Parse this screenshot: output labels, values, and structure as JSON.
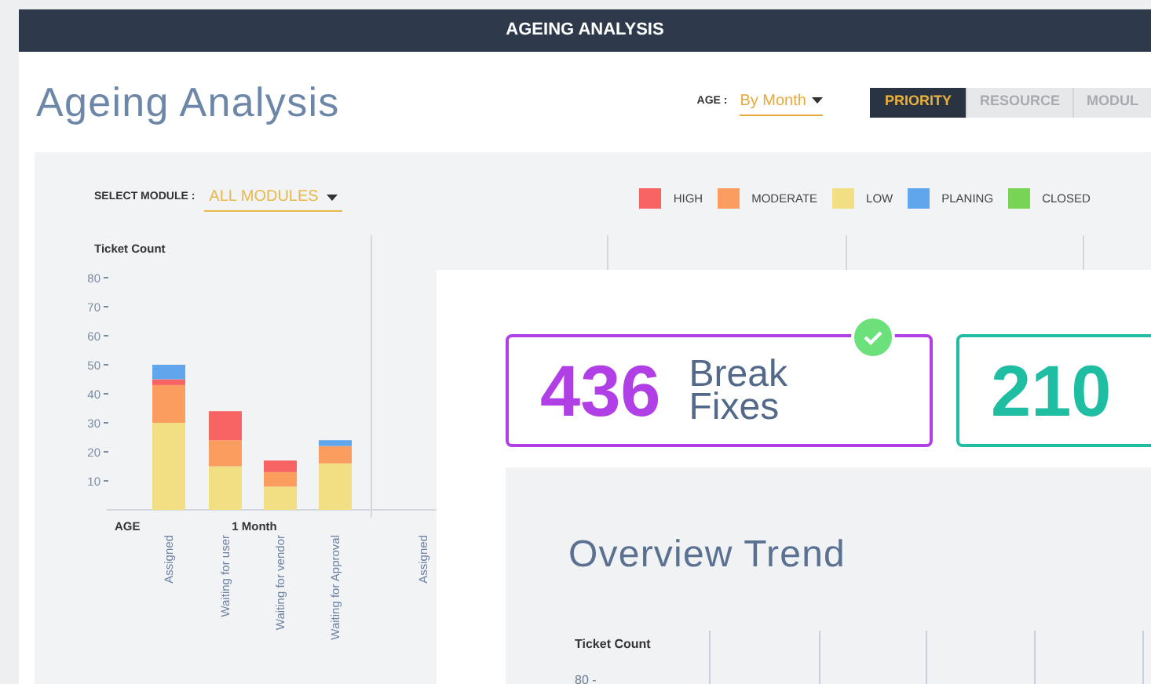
{
  "window": {
    "title": "AGEING ANALYSIS"
  },
  "page_title": "Ageing Analysis",
  "age_filter": {
    "label": "AGE :",
    "value": "By Month"
  },
  "tabs": [
    {
      "label": "PRIORITY",
      "selected": true
    },
    {
      "label": "RESOURCE",
      "selected": false
    },
    {
      "label": "MODUL",
      "selected": false
    }
  ],
  "module_filter": {
    "label": "SELECT MODULE :",
    "value": "ALL MODULES"
  },
  "chart": {
    "group_label": "1 Month",
    "chart_data": {
      "type": "bar",
      "stacked": true,
      "xlabel": "AGE",
      "ylabel": "Ticket Count",
      "categories": [
        "Assigned",
        "Waiting for user",
        "Waiting for vendor",
        "Waiting for Approval",
        "Assigned"
      ],
      "series": [
        {
          "name": "HIGH",
          "color": "#f86464",
          "values": [
            2,
            10,
            4,
            0,
            null
          ]
        },
        {
          "name": "MODERATE",
          "color": "#fb9d5f",
          "values": [
            13,
            9,
            5,
            6,
            null
          ]
        },
        {
          "name": "LOW",
          "color": "#f2df84",
          "values": [
            30,
            15,
            8,
            16,
            null
          ]
        },
        {
          "name": "PLANING",
          "color": "#5fa6ec",
          "values": [
            5,
            0,
            0,
            2,
            null
          ]
        },
        {
          "name": "CLOSED",
          "color": "#77d455",
          "values": [
            0,
            0,
            0,
            0,
            null
          ]
        }
      ],
      "ylim": [
        0,
        80
      ],
      "yticks": [
        10,
        20,
        30,
        40,
        50,
        60,
        70,
        80
      ]
    }
  },
  "cards": [
    {
      "value": "436",
      "label": "Break Fixes",
      "color": "#b13fe6",
      "checked": true
    },
    {
      "value": "210",
      "color": "#1fbea2"
    }
  ],
  "overview": {
    "title": "Overview Trend",
    "axis_label": "Ticket Count",
    "tick": "80 -"
  }
}
